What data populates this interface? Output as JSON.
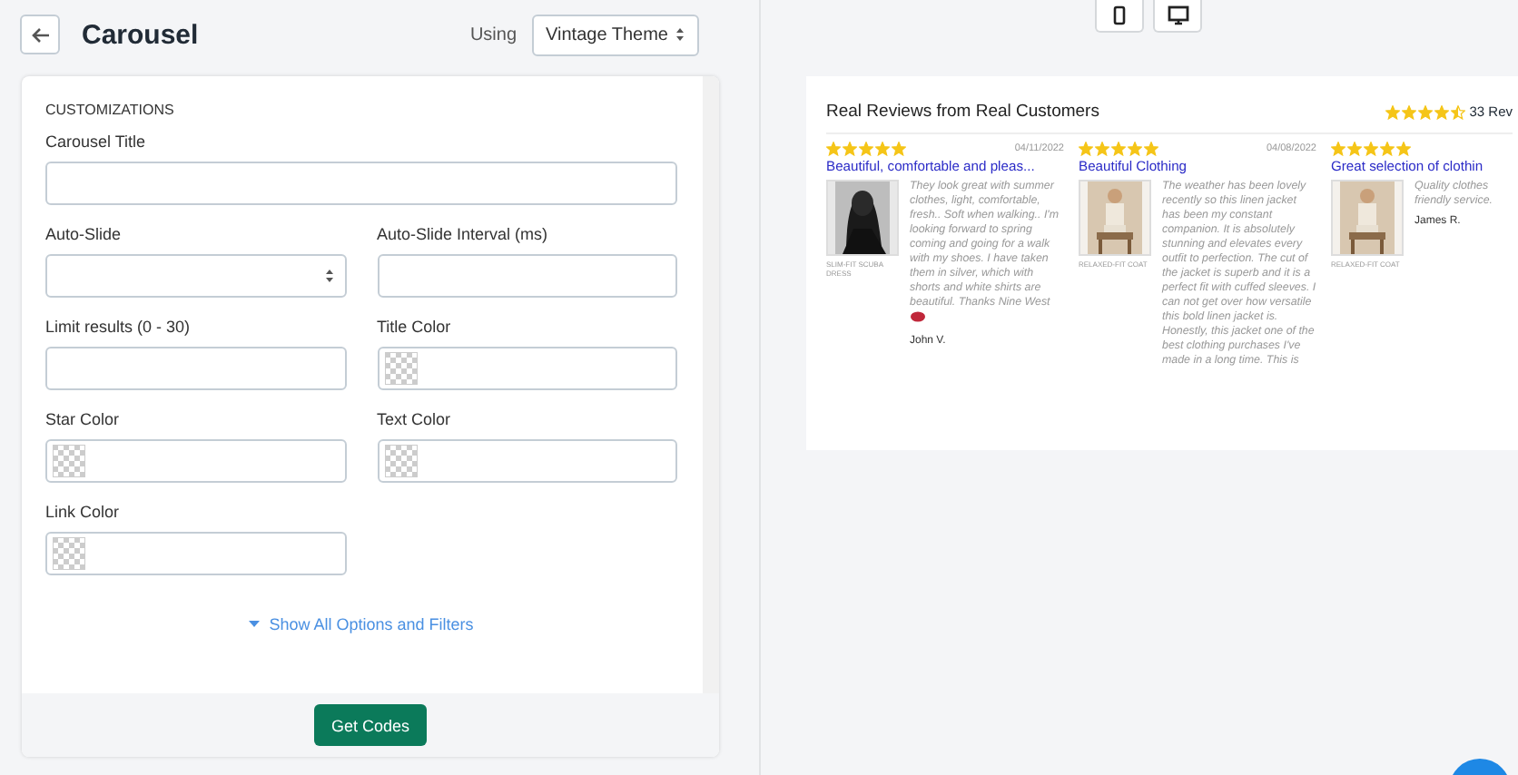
{
  "header": {
    "title": "Carousel",
    "theme_label": "Using",
    "theme_select": "Vintage Theme"
  },
  "form": {
    "section": "CUSTOMIZATIONS",
    "rows": [
      [
        {
          "label": "Carousel Title",
          "kind": "text"
        }
      ],
      [
        {
          "label": "Auto-Slide",
          "kind": "select"
        },
        {
          "label": "Auto-Slide Interval (ms)",
          "kind": "text"
        }
      ],
      [
        {
          "label": "Limit results (0 - 30)",
          "kind": "text"
        },
        {
          "label": "Title Color",
          "kind": "color"
        }
      ],
      [
        {
          "label": "Star Color",
          "kind": "color"
        },
        {
          "label": "Text Color",
          "kind": "color"
        }
      ],
      [
        {
          "label": "Link Color",
          "kind": "color"
        }
      ]
    ],
    "toggle_link": "Show All Options and Filters",
    "submit": "Get Codes"
  },
  "preview": {
    "devices": [
      {
        "kind": "mobile"
      },
      {
        "kind": "desktop"
      }
    ],
    "widget": {
      "title": "Real Reviews from Real Customers",
      "summary": {
        "stars": 4.5,
        "count": "33 Rev"
      },
      "reviews": [
        {
          "stars": 5,
          "date": "04/11/2022",
          "title": "Beautiful, comfortable and pleas...",
          "product": "SLIM-FIT SCUBA DRESS",
          "body": "They look great with summer clothes, light, comfortable, fresh.. Soft when walking.. I'm looking forward to spring coming and going for a walk with my shoes. I have taken them in silver, which with shorts and white shirts are beautiful. Thanks Nine West",
          "heart": true,
          "author": "John V."
        },
        {
          "stars": 5,
          "date": "04/08/2022",
          "title": "Beautiful Clothing",
          "product": "RELAXED-FIT COAT",
          "body": "The weather has been lovely recently so this linen jacket has been my constant companion. It is absolutely stunning and elevates every outfit to perfection. The cut of the jacket is superb and it is a perfect fit with cuffed sleeves. I can not get over how versatile this bold linen jacket is. Honestly, this jacket one of the best clothing purchases I've made in a long time. This is",
          "heart": false
        },
        {
          "stars": 5,
          "title": "Great selection of clothin",
          "product": "RELAXED-FIT COAT",
          "body": "Quality clothes friendly service.",
          "heart": false,
          "author": "James R."
        }
      ]
    }
  }
}
